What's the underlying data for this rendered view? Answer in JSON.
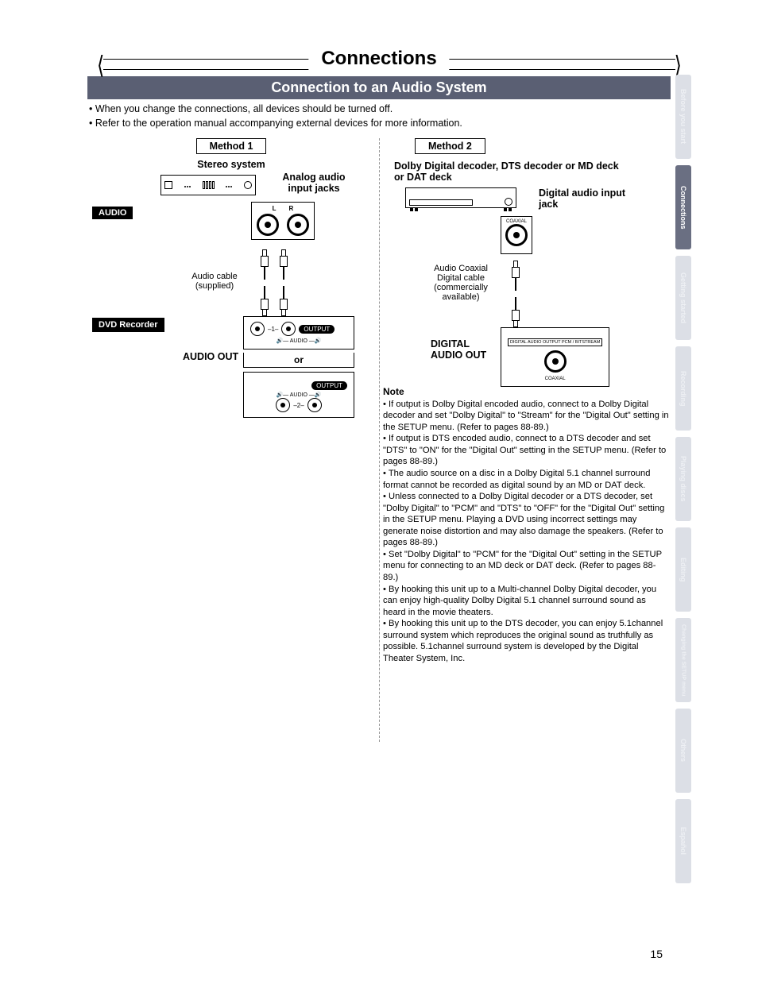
{
  "pageTitle": "Connections",
  "subTitle": "Connection to an Audio System",
  "intro": [
    "• When you change the connections, all devices should be turned off.",
    "• Refer to the operation manual accompanying external devices for more information."
  ],
  "method1": {
    "label": "Method 1",
    "stereo": "Stereo system",
    "analog": "Analog audio input jacks",
    "audio_pill": "AUDIO",
    "cable": "Audio cable (supplied)",
    "dvd_pill": "DVD Recorder",
    "audio_out": "AUDIO OUT",
    "or": "or",
    "output": "OUTPUT",
    "panel_audio": "AUDIO",
    "jack_l": "L",
    "jack_r": "R",
    "num1": "1",
    "num2": "2"
  },
  "method2": {
    "label": "Method 2",
    "title": "Dolby Digital decoder, DTS decoder or MD deck or DAT deck",
    "digital_input": "Digital audio input jack",
    "coax_lbl": "COAXIAL",
    "cable": "Audio Coaxial Digital cable (commercially available)",
    "dao": "DIGITAL AUDIO OUT",
    "panel_lbl": "DIGITAL AUDIO OUTPUT PCM / BITSTREAM",
    "coax2": "COAXIAL"
  },
  "note": {
    "title": "Note",
    "items": [
      "• If output is Dolby Digital encoded audio, connect to a Dolby Digital decoder and set \"Dolby Digital\" to \"Stream\" for the \"Digital Out\" setting in the SETUP menu. (Refer to pages 88-89.)",
      "• If output is DTS encoded audio, connect to a DTS decoder and set \"DTS\" to \"ON\" for the \"Digital Out\" setting in the SETUP menu. (Refer to pages 88-89.)",
      "• The audio source on a disc in a Dolby Digital 5.1 channel surround format cannot be recorded as digital sound by an MD or DAT deck.",
      "• Unless connected to a Dolby Digital decoder or a DTS decoder, set \"Dolby Digital\" to \"PCM\" and \"DTS\" to \"OFF\" for the \"Digital Out\" setting in the SETUP menu. Playing a DVD using incorrect settings may generate noise distortion and may also damage the speakers. (Refer to pages 88-89.)",
      "• Set \"Dolby Digital\" to \"PCM\" for the \"Digital Out\" setting in the SETUP menu for connecting to an MD deck or DAT deck. (Refer to pages 88-89.)",
      "• By hooking this unit up to a Multi-channel Dolby Digital decoder, you can enjoy high-quality Dolby Digital 5.1 channel surround sound as heard in the movie theaters.",
      "• By hooking this unit up to the DTS decoder, you can enjoy 5.1channel surround system which reproduces the original sound as truthfully as possible. 5.1channel surround system is developed by the Digital Theater System, Inc."
    ]
  },
  "tabs": [
    "Before you start",
    "Connections",
    "Getting started",
    "Recording",
    "Playing discs",
    "Editing",
    "Changing the SETUP menu",
    "Others",
    "Español"
  ],
  "activeTab": 1,
  "pageNumber": "15"
}
